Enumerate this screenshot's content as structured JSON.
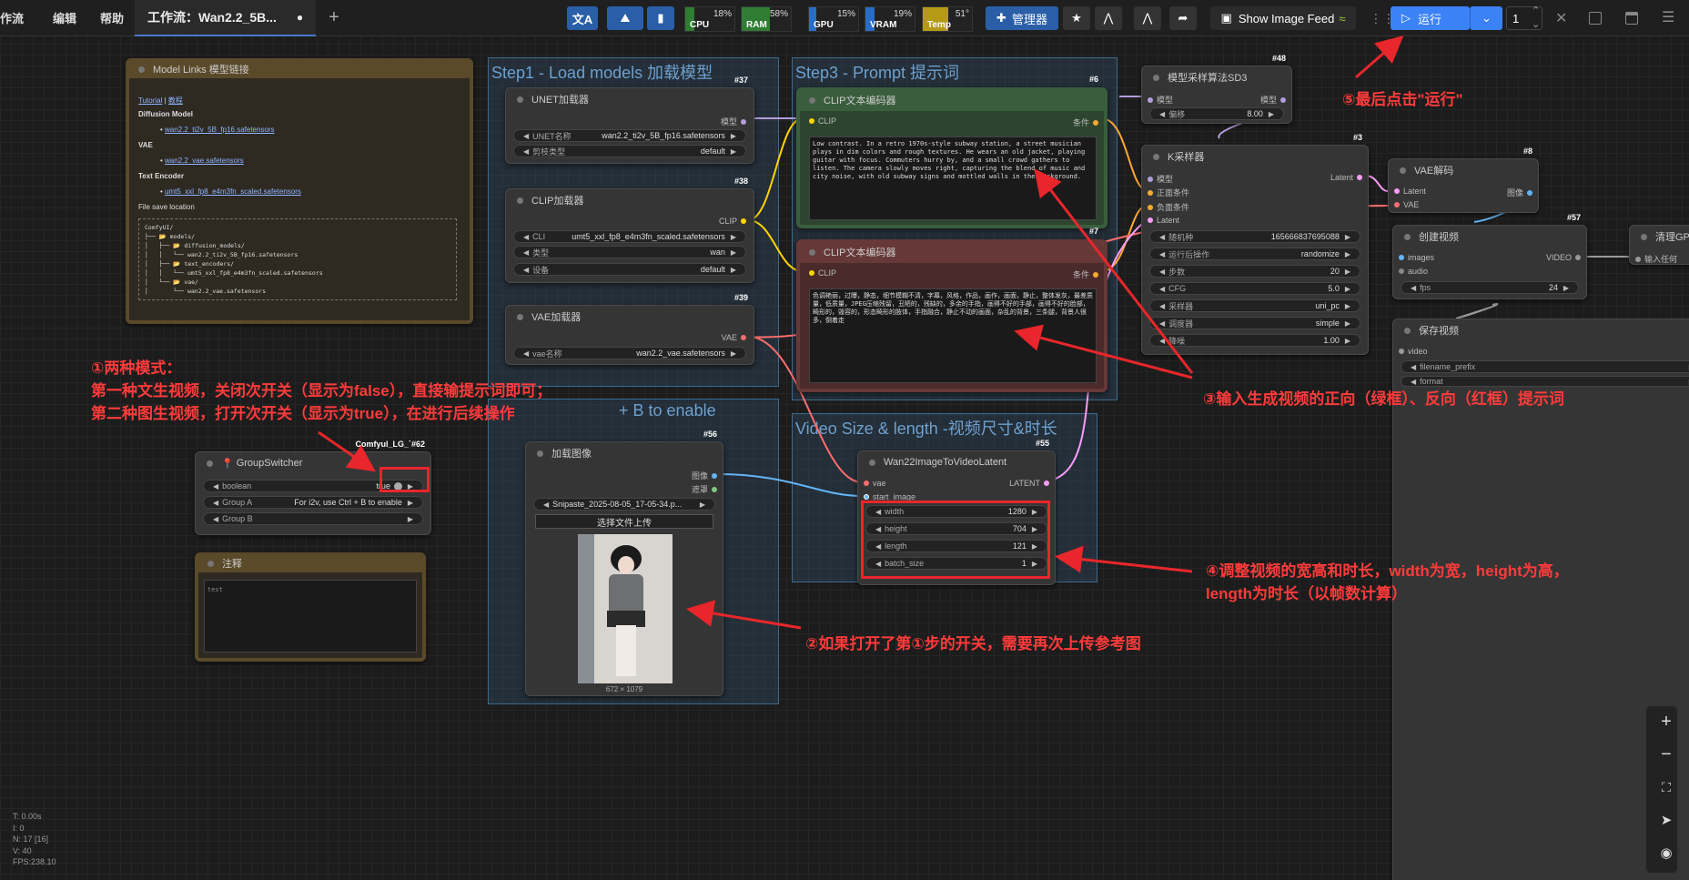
{
  "menu": [
    "作流",
    "编辑",
    "帮助"
  ],
  "workflow_tab": {
    "title": "工作流：Wan2.2_5B...",
    "dot": "●"
  },
  "meters": [
    {
      "name": "CPU",
      "pct": "18%",
      "fill": 0.18,
      "color": "#2e7d32"
    },
    {
      "name": "RAM",
      "pct": "58%",
      "fill": 0.58,
      "color": "#2e7d32"
    },
    {
      "name": "GPU",
      "pct": "15%",
      "fill": 0.15,
      "color": "#2a6dc4"
    },
    {
      "name": "VRAM",
      "pct": "19%",
      "fill": 0.19,
      "color": "#2a6dc4"
    },
    {
      "name": "Temp",
      "pct": "51°",
      "fill": 0.51,
      "color": "#b59a16"
    }
  ],
  "toolbar": {
    "manager": "管理器",
    "show_image_feed": "Show Image Feed",
    "run": "运行",
    "queue_count": "1"
  },
  "groups": {
    "step1": "Step1 - Load models  加载模型",
    "step3": "Step3 - Prompt  提示词",
    "step2_visible": "+ B to enable",
    "video_size": "Video Size & length -视频尺寸&时长"
  },
  "model_links": {
    "title": "Model Links 模型链接",
    "tutorial": "Tutorial",
    "sep": " | ",
    "tutorial_cn": "教程",
    "diffusion_h": "Diffusion Model",
    "diffusion_f": "wan2.2_ti2v_5B_fp16.safetensors",
    "vae_h": "VAE",
    "vae_f": "wan2.2_vae.safetensors",
    "te_h": "Text Encoder",
    "te_f": "umt5_xxl_fp8_e4m3fn_scaled.safetensors",
    "save_h": "File save location",
    "tree": "ComfyUI/\n├── 📂 models/\n│   ├── 📂 diffusion_models/\n│   │   └── wan2.2_ti2v_5B_fp16.safetensors\n│   ├── 📂 text_encoders/\n│   │   └── umt5_xxl_fp8_e4m3fn_scaled.safetensors\n│   └── 📂 vae/\n│       └── wan2.2_vae.safetensors"
  },
  "unet": {
    "badge": "#37",
    "title": "UNET加载器",
    "out": "模型",
    "w1_label": "UNET名称",
    "w1_value": "wan2.2_ti2v_5B_fp16.safetensors",
    "w2_label": "剪枝类型",
    "w2_value": "default"
  },
  "clip_loader": {
    "badge": "#38",
    "title": "CLIP加载器",
    "out": "CLIP",
    "w1_label": "CLI",
    "w1_value": "umt5_xxl_fp8_e4m3fn_scaled.safetensors",
    "w2_label": "类型",
    "w2_value": "wan",
    "w3_label": "设备",
    "w3_value": "default"
  },
  "vae_loader": {
    "badge": "#39",
    "title": "VAE加载器",
    "out": "VAE",
    "w1_label": "vae名称",
    "w1_value": "wan2.2_vae.safetensors"
  },
  "clip_pos": {
    "badge": "#6",
    "title": "CLIP文本编码器",
    "in": "CLIP",
    "out": "条件",
    "text": "Low contrast. In a retro 1970s-style subway station, a street musician plays in dim colors and rough textures. He wears an old jacket, playing guitar with focus. Commuters hurry by, and a small crowd gathers to listen. The camera slowly moves right, capturing the blend of music and city noise, with old subway signs and mottled walls in the background."
  },
  "clip_neg": {
    "badge": "#7",
    "title": "CLIP文本编码器",
    "in": "CLIP",
    "out": "条件",
    "text": "色调艳丽，过曝，静态，细节模糊不清，字幕，风格，作品，画作，画面，静止，整体发灰，最差质量，低质量，JPEG压缩残留，丑陋的，残缺的，多余的手指，画得不好的手部，画得不好的脸部，畸形的，毁容的，形态畸形的肢体，手指融合，静止不动的画面，杂乱的背景，三条腿，背景人很多，倒着走"
  },
  "sd3": {
    "badge": "#48",
    "title": "模型采样算法SD3",
    "in": "模型",
    "out": "模型",
    "w1_label": "偏移",
    "w1_value": "8.00"
  },
  "ksampler": {
    "badge": "#3",
    "title": "K采样器",
    "in1": "模型",
    "in2": "正面条件",
    "in3": "负面条件",
    "in4": "Latent",
    "out": "Latent",
    "seed_l": "随机种",
    "seed_v": "165666837695088",
    "ctl_l": "运行后操作",
    "ctl_v": "randomize",
    "steps_l": "步数",
    "steps_v": "20",
    "cfg_l": "CFG",
    "cfg_v": "5.0",
    "sampler_l": "采样器",
    "sampler_v": "uni_pc",
    "sched_l": "调度器",
    "sched_v": "simple",
    "denoise_l": "降噪",
    "denoise_v": "1.00"
  },
  "vae_decode": {
    "badge": "#8",
    "title": "VAE解码",
    "in1": "Latent",
    "in2": "VAE",
    "out": "图像"
  },
  "create_video": {
    "badge": "#57",
    "title": "创建视频",
    "in1": "images",
    "in2": "audio",
    "out": "VIDEO",
    "w1_label": "fps",
    "w1_value": "24"
  },
  "save_video": {
    "title": "保存视频",
    "in1": "video",
    "w1": "filename_prefix",
    "w2": "format"
  },
  "clear_gpu": {
    "title": "清理GPU",
    "in": "输入任何"
  },
  "switcher": {
    "badge": "Comfyul_LG_`#62",
    "title": "GroupSwitcher",
    "w0_label": "boolean",
    "w0_value": "true",
    "w1_label": "Group A",
    "w1_value": "For i2v, use Ctrl + B to enable",
    "w2_label": "Group B"
  },
  "note": {
    "title": "注释",
    "text": "test"
  },
  "load_image": {
    "badge": "#56",
    "title": "加载图像",
    "out1": "图像",
    "out2": "遮罩",
    "w1_value": "Snipaste_2025-08-05_17-05-34.p...",
    "upload": "选择文件上传",
    "size": "672 × 1079"
  },
  "wan22": {
    "badge": "#55",
    "title": "Wan22ImageToVideoLatent",
    "in1": "vae",
    "in2": "start_image",
    "out": "LATENT",
    "width_l": "width",
    "width_v": "1280",
    "height_l": "height",
    "height_v": "704",
    "length_l": "length",
    "length_v": "121",
    "batch_l": "batch_size",
    "batch_v": "1"
  },
  "annotations": {
    "a1_1": "①两种模式：",
    "a1_2": "第一种文生视频，关闭次开关（显示为false），直接输提示词即可；",
    "a1_3": "第二种图生视频，打开次开关（显示为true），在进行后续操作",
    "a2": "②如果打开了第①步的开关，需要再次上传参考图",
    "a3": "③输入生成视频的正向（绿框）、反向（红框）提示词",
    "a4_1": "④调整视频的宽高和时长，width为宽，height为高，",
    "a4_2": "length为时长（以帧数计算）",
    "a5": "⑤最后点击\"运行\""
  },
  "stats": {
    "t": "T: 0.00s",
    "i": "I: 0",
    "n": "N: 17 [16]",
    "v": "V: 40",
    "fps": "FPS:238.10"
  }
}
